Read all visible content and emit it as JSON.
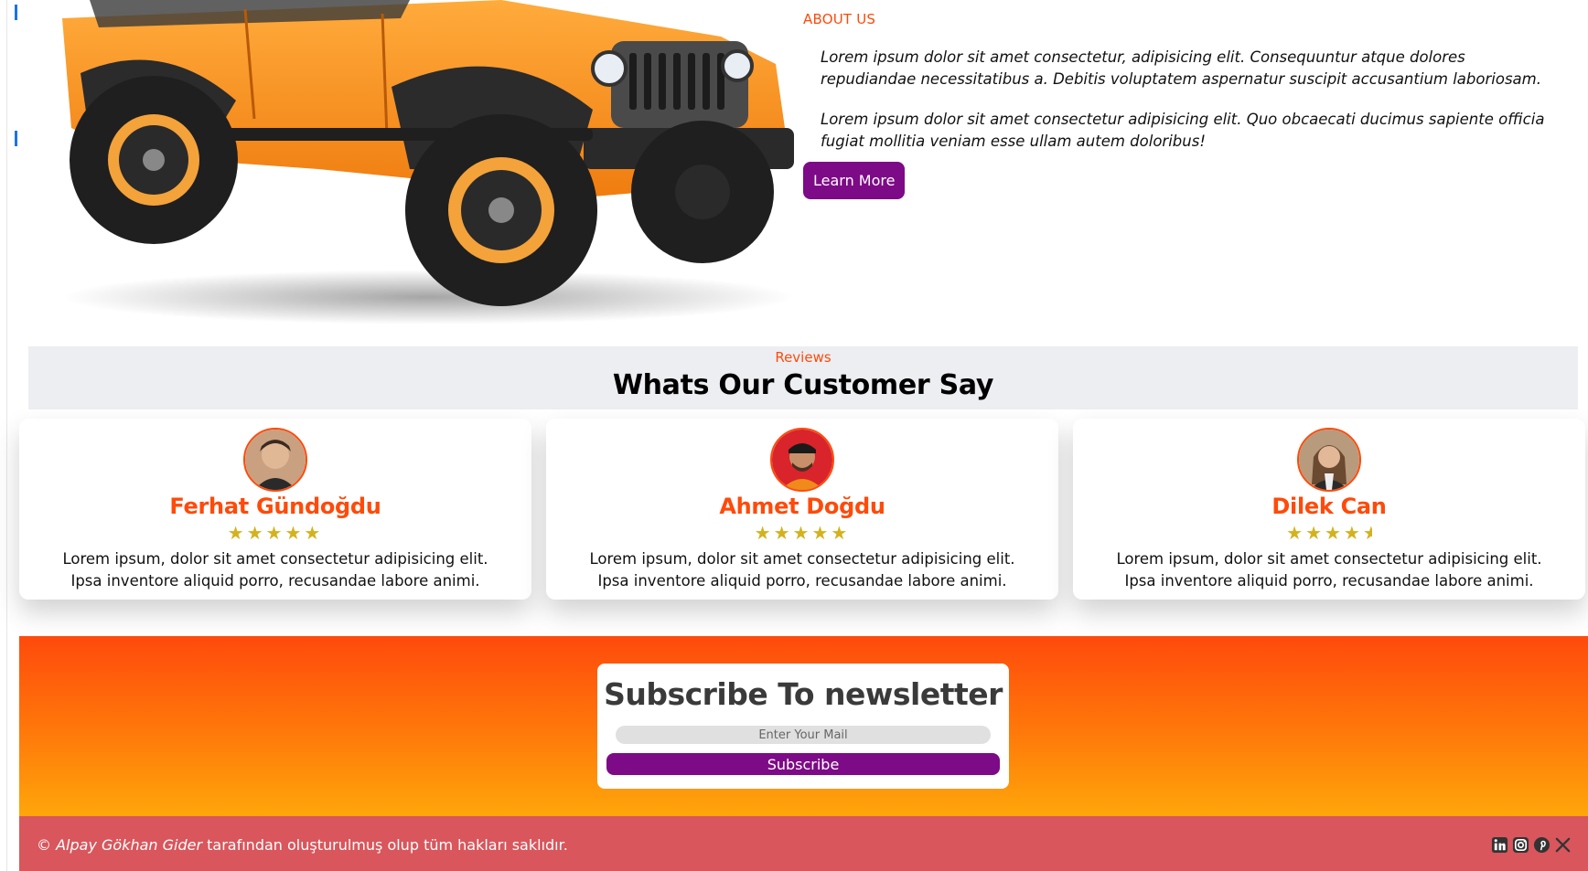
{
  "about": {
    "kicker": "ABOUT US",
    "paragraph_1": "Lorem ipsum dolor sit amet consectetur, adipisicing elit. Consequuntur atque dolores repudiandae necessitatibus a. Debitis voluptatem aspernatur suscipit accusantium laboriosam.",
    "paragraph_2": "Lorem ipsum dolor sit amet consectetur adipisicing elit. Quo obcaecati ducimus sapiente officia fugiat mollitia veniam esse ullam autem doloribus!",
    "button_label": "Learn More",
    "image_icon": "orange-jeep-image"
  },
  "reviews": {
    "kicker": "Reviews",
    "title": "Whats Our Customer Say",
    "cards": [
      {
        "name": "Ferhat Gündoğdu",
        "rating": 5,
        "stars": "★★★★★",
        "text": "Lorem ipsum, dolor sit amet consectetur adipisicing elit. Ipsa inventore aliquid porro, recusandae labore animi."
      },
      {
        "name": "Ahmet Doğdu",
        "rating": 5,
        "stars": "★★★★★",
        "text": "Lorem ipsum, dolor sit amet consectetur adipisicing elit. Ipsa inventore aliquid porro, recusandae labore animi."
      },
      {
        "name": "Dilek Can",
        "rating": 4.5,
        "stars": "★★★★",
        "text": "Lorem ipsum, dolor sit amet consectetur adipisicing elit. Ipsa inventore aliquid porro, recusandae labore animi."
      }
    ]
  },
  "newsletter": {
    "title": "Subscribe To newsletter",
    "placeholder": "Enter Your Mail",
    "button_label": "Subscribe"
  },
  "footer": {
    "copyright_symbol": "©",
    "author": "Alpay Gökhan Gider",
    "text": "tarafından oluşturulmuş olup tüm hakları saklıdır.",
    "social_icons": [
      "linkedin-icon",
      "instagram-icon",
      "pinterest-icon",
      "x-icon"
    ]
  },
  "colors": {
    "accent": "#ff4a0a",
    "button": "#7d0a86",
    "star": "#d4b21e",
    "footer": "#d9565c",
    "band_top": "#ff4a0c",
    "band_bottom": "#ffa60a"
  }
}
